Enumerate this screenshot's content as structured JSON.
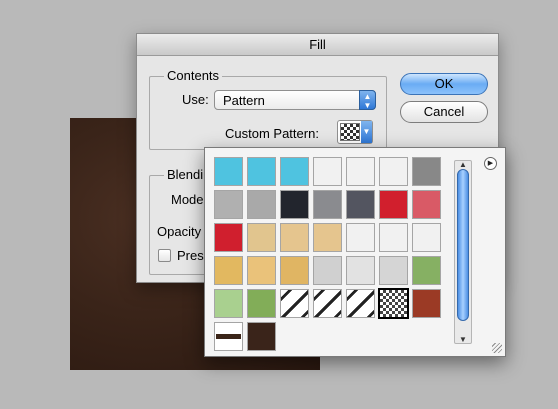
{
  "dialog": {
    "title": "Fill",
    "contents_group": "Contents",
    "use_label": "Use:",
    "use_value": "Pattern",
    "custom_pattern_label": "Custom Pattern:",
    "blending_group": "Blendi",
    "mode_label": "Mode",
    "opacity_label": "Opacity",
    "preserve_label": "Prese",
    "ok_label": "OK",
    "cancel_label": "Cancel"
  },
  "pattern_picker": {
    "swatches": [
      "#4fc3e0",
      "#4fc3e0",
      "#4fc3e0",
      "#f1f1f1",
      "#f1f1f1",
      "#f1f1f1",
      "#888888",
      "#b0b0b0",
      "#a9a9a9",
      "#22252d",
      "#8a8b8f",
      "#535560",
      "#d11f2d",
      "#d95a66",
      "#d01f2e",
      "#e1c58e",
      "#e5c58e",
      "#e5c58e",
      "#f1f1f1",
      "#f1f1f1",
      "#f1f1f1",
      "#e2b860",
      "#eac27a",
      "#e0b563",
      "#d0d0d0",
      "#e2e2e2",
      "#d5d5d5",
      "#86b063",
      "#a9d08f",
      "#82ad58",
      "diagonal",
      "diagonal",
      "diagonal",
      "checker",
      "#9b3a25",
      "line",
      "#3a241a"
    ],
    "selected_index": 33
  },
  "colors": {
    "accent": "#2f78d7",
    "dialog_bg": "#e6e6e6",
    "texture": "#3a2419"
  }
}
